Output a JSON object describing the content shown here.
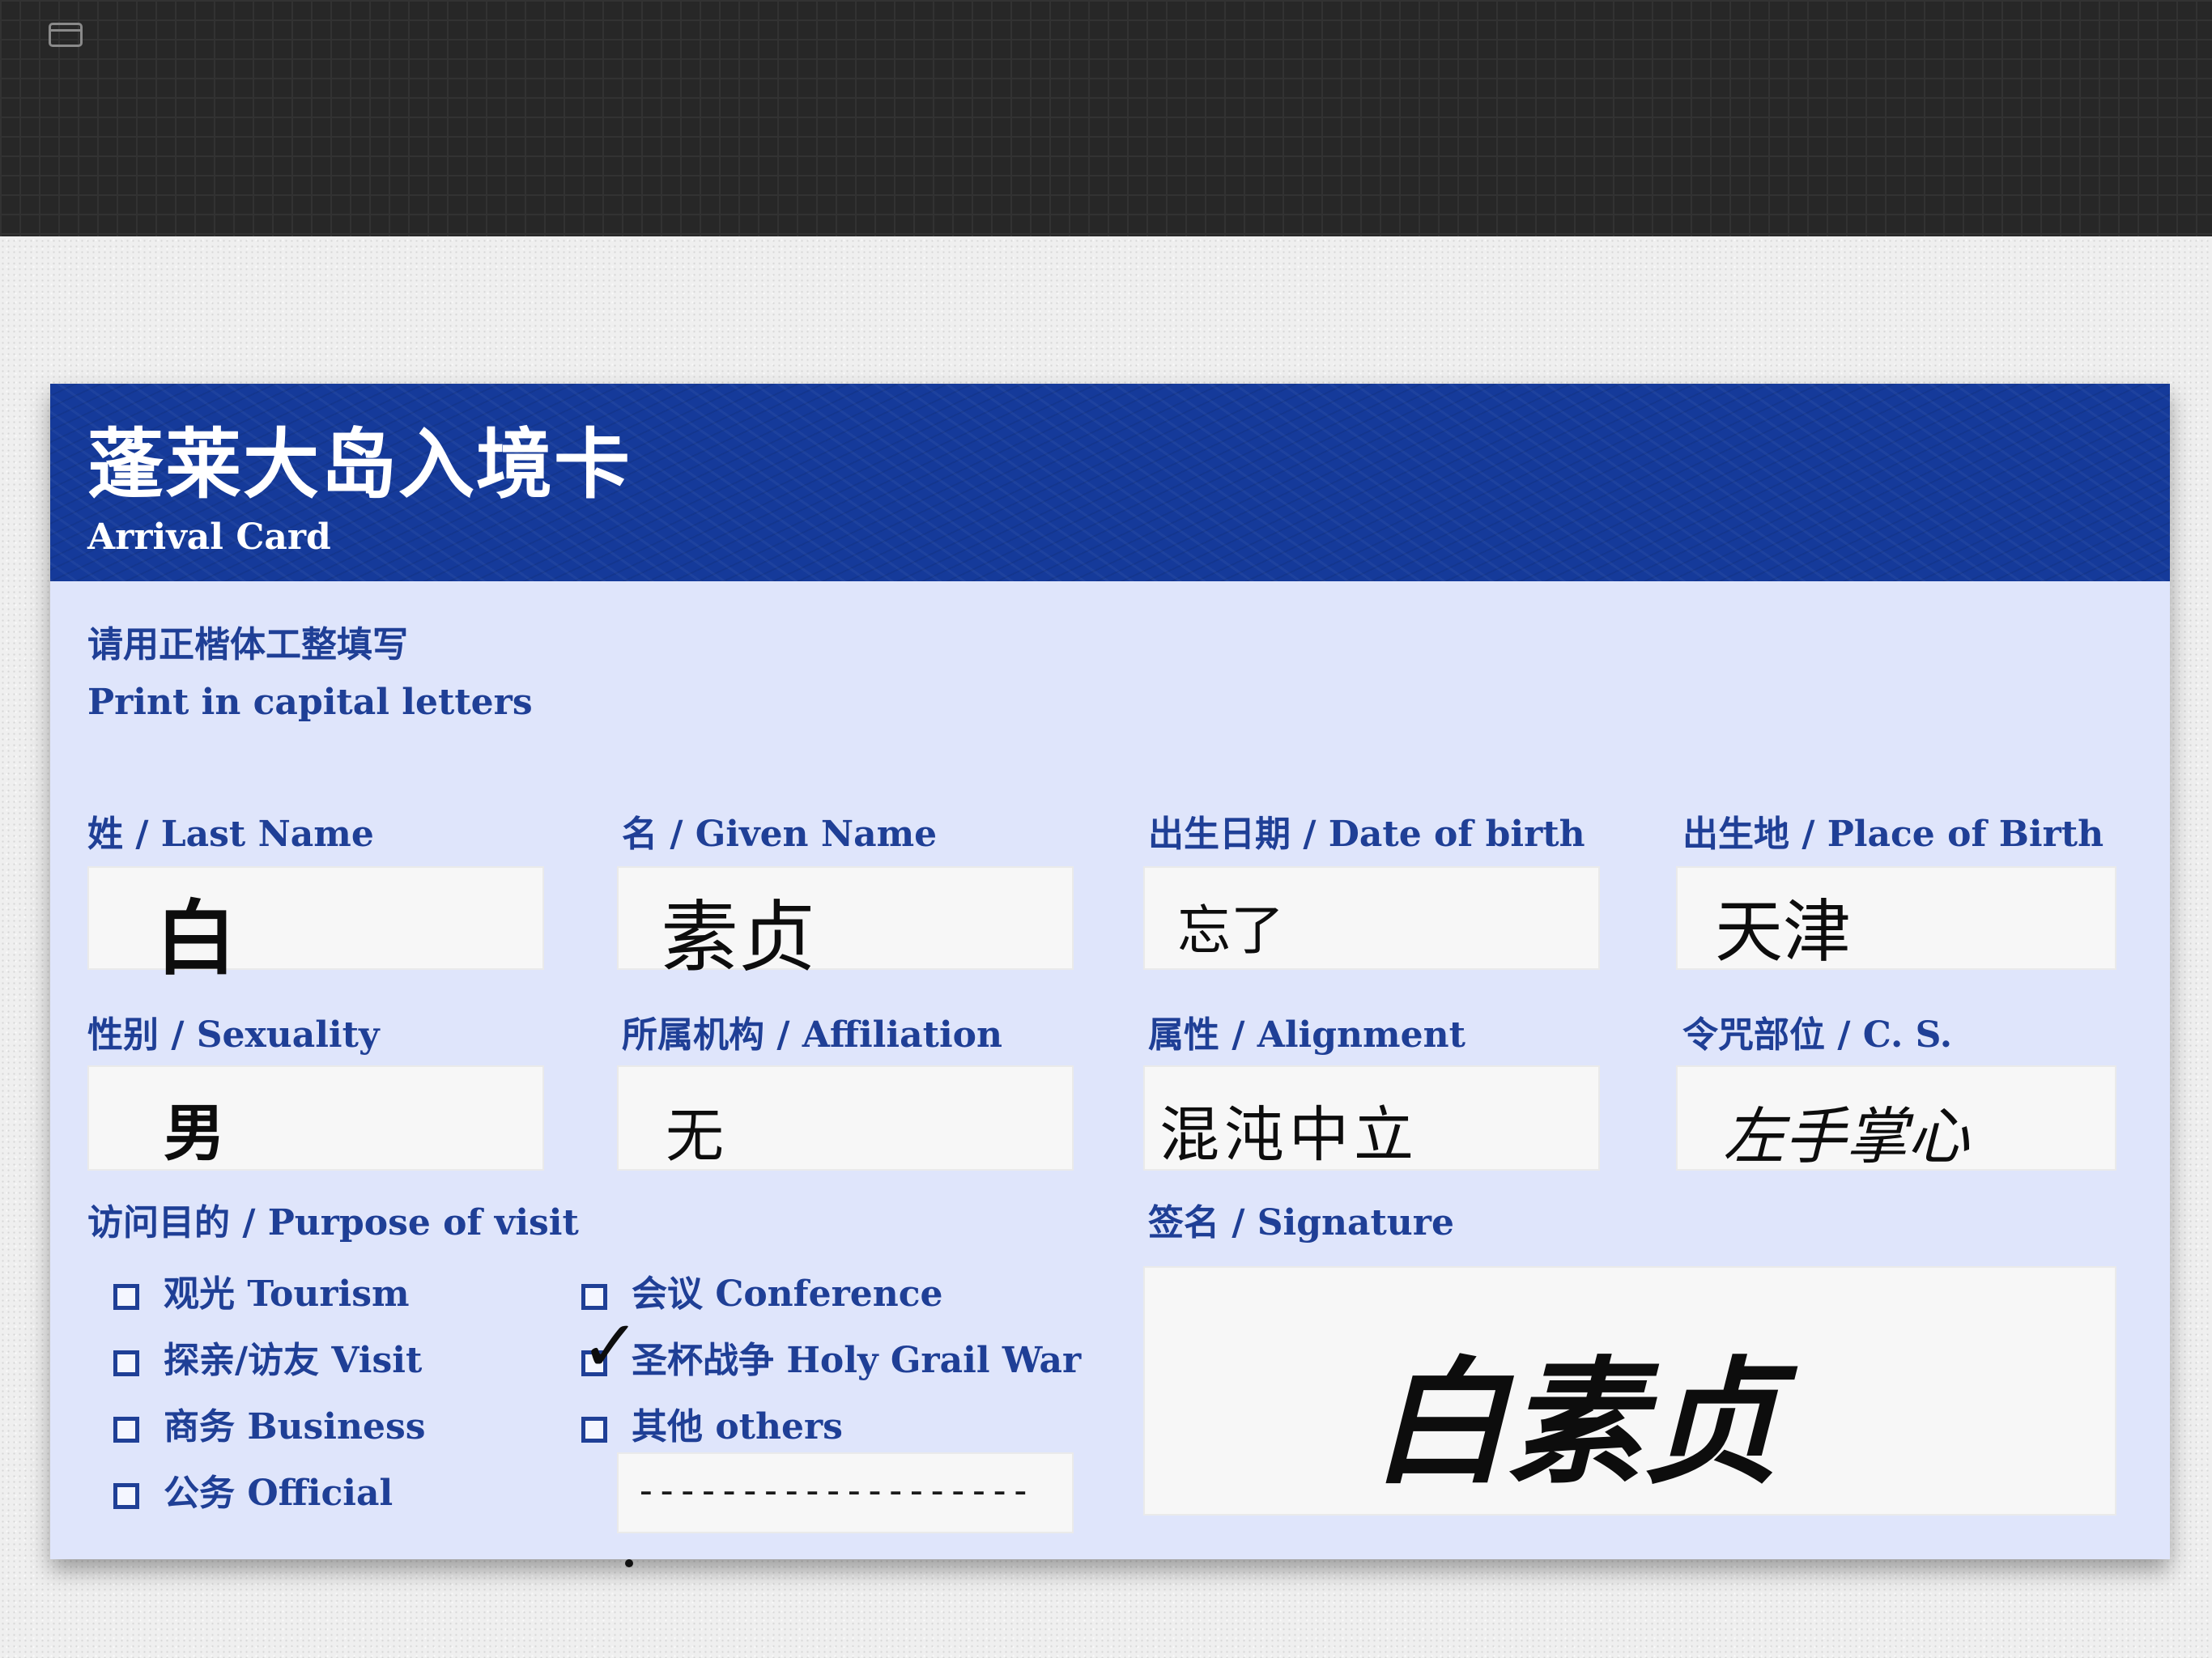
{
  "card": {
    "title": "蓬莱大岛入境卡",
    "subtitle": "Arrival Card",
    "instruction_cn": "请用正楷体工整填写",
    "instruction_en": "Print in capital letters"
  },
  "fields": {
    "last_name": {
      "label": "姓 / Last Name",
      "value": "白"
    },
    "given_name": {
      "label": "名 / Given Name",
      "value": "素贞"
    },
    "date_of_birth": {
      "label": "出生日期 / Date of birth",
      "value": "忘了"
    },
    "place_of_birth": {
      "label": "出生地 / Place of Birth",
      "value": "天津"
    },
    "sexuality": {
      "label": "性别 / Sexuality",
      "value": "男"
    },
    "affiliation": {
      "label": "所属机构 / Affiliation",
      "value": "无"
    },
    "alignment": {
      "label": "属性 / Alignment",
      "value": "混沌中立"
    },
    "cs": {
      "label": "令咒部位 / C. S.",
      "value": "左手掌心"
    }
  },
  "purpose": {
    "label": "访问目的 / Purpose of visit",
    "options": [
      {
        "label": "观光 Tourism",
        "checked": false
      },
      {
        "label": "探亲/访友 Visit",
        "checked": false
      },
      {
        "label": "商务 Business",
        "checked": false
      },
      {
        "label": "公务 Official",
        "checked": false
      },
      {
        "label": "会议 Conference",
        "checked": false
      },
      {
        "label": "圣杯战争 Holy Grail War",
        "checked": true
      },
      {
        "label": "其他 others",
        "checked": false
      }
    ],
    "others_value": "-------------------"
  },
  "signature": {
    "label": "签名 / Signature",
    "value": "白素贞"
  },
  "colors": {
    "header_blue": "#153a9a",
    "label_blue": "#1f3f96",
    "card_background": "#dfe5fb",
    "field_background": "#f7f7f7"
  },
  "icons": {
    "window": "window-icon",
    "checkbox": "checkbox-icon",
    "check_mark": "check-mark-icon"
  }
}
